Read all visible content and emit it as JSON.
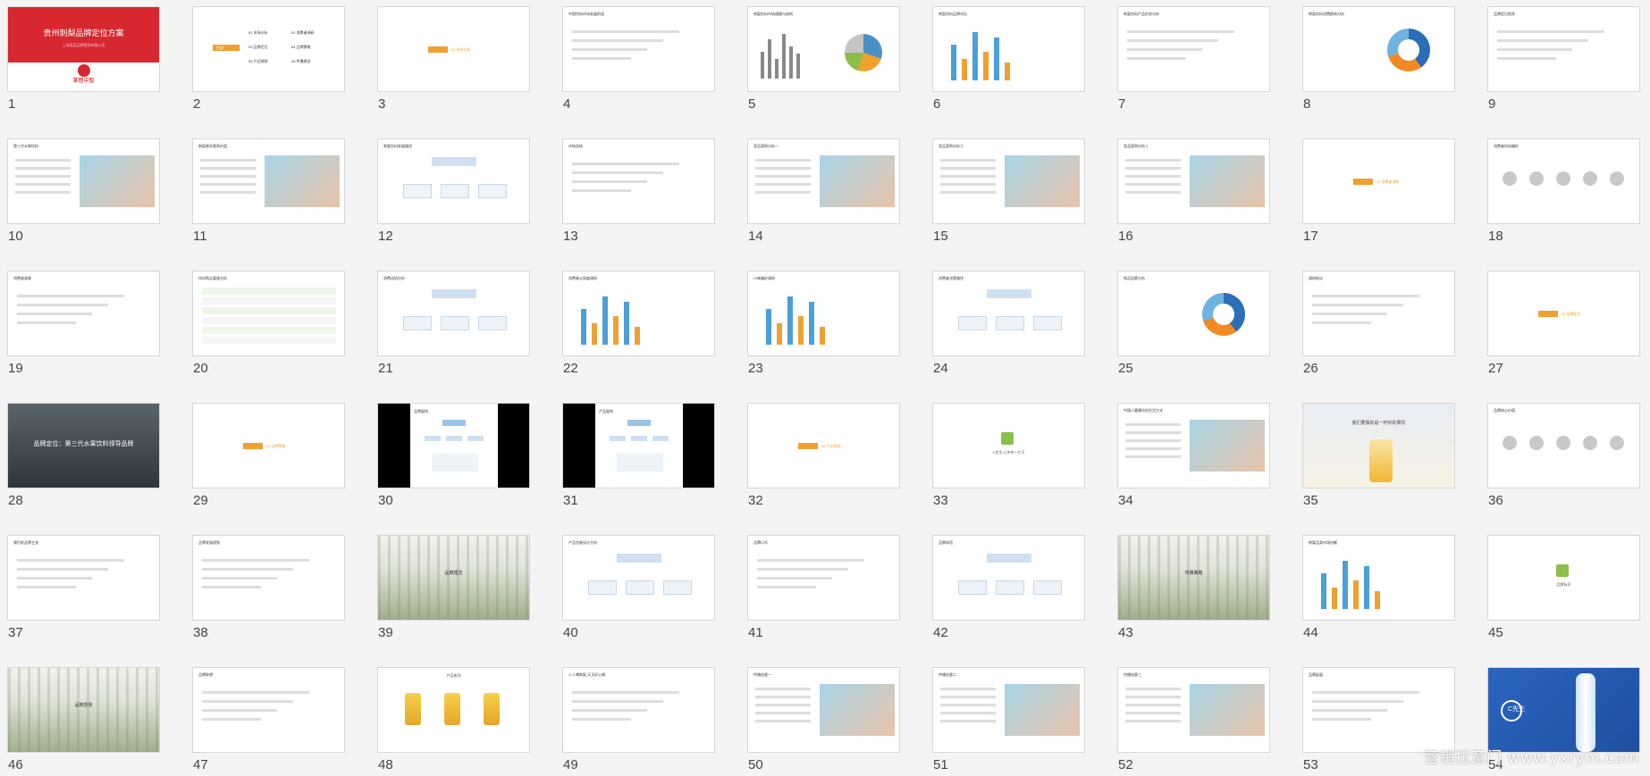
{
  "slides": [
    {
      "num": "1",
      "kind": "cover",
      "title": "贵州刺梨品牌定位方案",
      "sub": "上海某某品牌策划有限公司",
      "brand": "某橙中智"
    },
    {
      "num": "2",
      "kind": "toc",
      "items": [
        "01 市场分析",
        "02 消费者调研",
        "03 品牌定位",
        "04 品牌策略",
        "05 产品规划",
        "06 传播建议"
      ],
      "tag": "目录"
    },
    {
      "num": "3",
      "kind": "section",
      "label": "01 市场分析"
    },
    {
      "num": "4",
      "kind": "text",
      "title": "中国饮料市场发展阶段"
    },
    {
      "num": "5",
      "kind": "chart",
      "title": "刺梨饮料市场规模与结构"
    },
    {
      "num": "6",
      "kind": "bar",
      "title": "刺梨饮料品牌对比"
    },
    {
      "num": "7",
      "kind": "text",
      "title": "刺梨饮料产品形态分析"
    },
    {
      "num": "8",
      "kind": "donut",
      "title": "刺梨饮料消费群体分析"
    },
    {
      "num": "9",
      "kind": "text",
      "title": "品牌定位矩阵"
    },
    {
      "num": "10",
      "kind": "photo",
      "title": "第三代水果饮料"
    },
    {
      "num": "11",
      "kind": "photo",
      "title": "刺梨果实营养价值"
    },
    {
      "num": "12",
      "kind": "diagram",
      "title": "刺梨饮料发展路径"
    },
    {
      "num": "13",
      "kind": "text",
      "title": "市场总结"
    },
    {
      "num": "14",
      "kind": "photo",
      "title": "竞品案例分析一"
    },
    {
      "num": "15",
      "kind": "photo",
      "title": "竞品案例分析二"
    },
    {
      "num": "16",
      "kind": "photo",
      "title": "竞品案例分析三"
    },
    {
      "num": "17",
      "kind": "section",
      "label": "02 消费者调研"
    },
    {
      "num": "18",
      "kind": "icons",
      "title": "消费者饮料偏好"
    },
    {
      "num": "19",
      "kind": "text",
      "title": "消费者画像"
    },
    {
      "num": "20",
      "kind": "table",
      "title": "饮料购买渠道分析"
    },
    {
      "num": "21",
      "kind": "diagram",
      "title": "消费动机分析"
    },
    {
      "num": "22",
      "kind": "bar",
      "title": "消费者认知度调研"
    },
    {
      "num": "23",
      "kind": "bar",
      "title": "口味偏好调研"
    },
    {
      "num": "24",
      "kind": "diagram",
      "title": "消费者决策路径"
    },
    {
      "num": "25",
      "kind": "donut",
      "title": "购买因素分析"
    },
    {
      "num": "26",
      "kind": "text",
      "title": "调研结论"
    },
    {
      "num": "27",
      "kind": "section",
      "label": "03 品牌定位"
    },
    {
      "num": "28",
      "kind": "dark",
      "title": "品牌定位：第三代水果饮料领导品牌"
    },
    {
      "num": "29",
      "kind": "section",
      "label": "04 品牌策略"
    },
    {
      "num": "30",
      "kind": "black",
      "title": "品牌架构"
    },
    {
      "num": "31",
      "kind": "black",
      "title": "产品架构"
    },
    {
      "num": "32",
      "kind": "section",
      "label": "05 产品规划"
    },
    {
      "num": "33",
      "kind": "logo",
      "title": "C先生 心中的一片天"
    },
    {
      "num": "34",
      "kind": "photo",
      "title": "中国人健康饮料生活方式"
    },
    {
      "num": "35",
      "kind": "lemon",
      "title": "我们要做的是一杯好的果饮"
    },
    {
      "num": "36",
      "kind": "icons",
      "title": "品牌核心价值"
    },
    {
      "num": "37",
      "kind": "text",
      "title": "我们的品牌主张"
    },
    {
      "num": "38",
      "kind": "text",
      "title": "品牌发展规划"
    },
    {
      "num": "39",
      "kind": "forest",
      "title": "品牌理念"
    },
    {
      "num": "40",
      "kind": "diagram",
      "title": "产品包装设计方向"
    },
    {
      "num": "41",
      "kind": "text",
      "title": "品牌口号"
    },
    {
      "num": "42",
      "kind": "diagram",
      "title": "品牌体验"
    },
    {
      "num": "43",
      "kind": "forest",
      "title": "传播策略"
    },
    {
      "num": "44",
      "kind": "bar",
      "title": "刺梨品类市场份额"
    },
    {
      "num": "45",
      "kind": "logo",
      "title": "品牌标识"
    },
    {
      "num": "46",
      "kind": "forest",
      "title": "品牌愿景"
    },
    {
      "num": "47",
      "kind": "text",
      "title": "品牌联想"
    },
    {
      "num": "48",
      "kind": "cans",
      "title": "产品系列"
    },
    {
      "num": "49",
      "kind": "text",
      "title": "人人喝刺梨 天天好心情"
    },
    {
      "num": "50",
      "kind": "photo",
      "title": "传播创意一"
    },
    {
      "num": "51",
      "kind": "photo",
      "title": "传播创意二"
    },
    {
      "num": "52",
      "kind": "photo",
      "title": "传播创意三"
    },
    {
      "num": "53",
      "kind": "text",
      "title": "品牌延展"
    },
    {
      "num": "54",
      "kind": "blue",
      "title": "C先生"
    }
  ],
  "watermark": "营销拉意门 www.yxrym.com",
  "colors": {
    "red": "#d7282f",
    "orange": "#f0a030",
    "blue": "#2a65c0",
    "dark": "#3b4048"
  }
}
